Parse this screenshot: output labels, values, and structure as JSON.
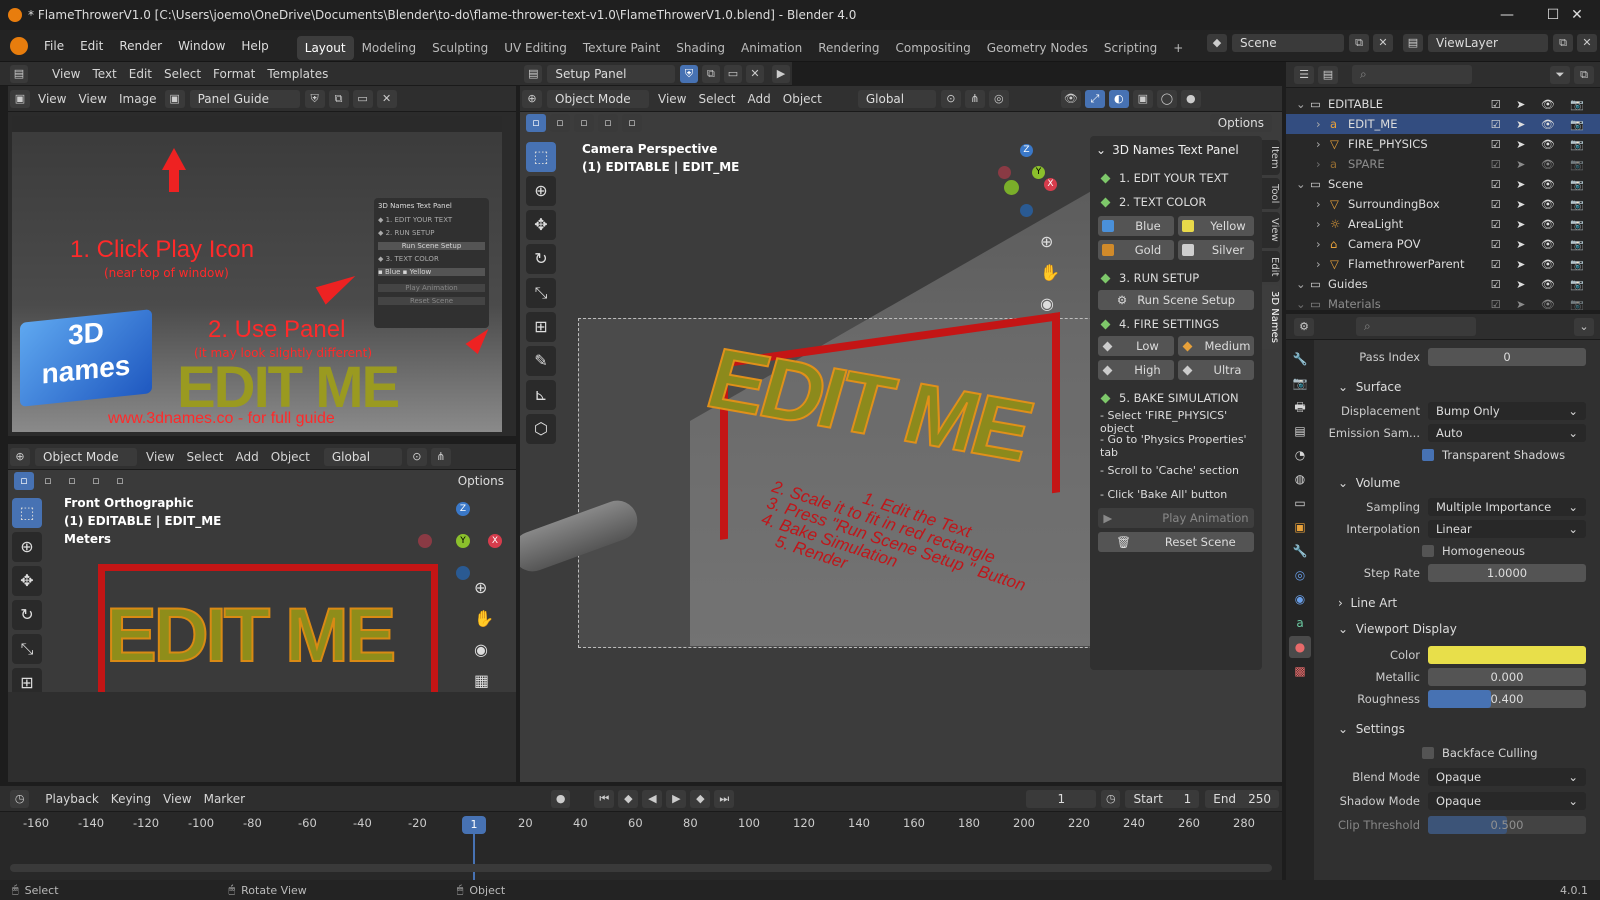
{
  "window": {
    "title": "* FlameThrowerV1.0 [C:\\Users\\joemo\\OneDrive\\Documents\\Blender\\to-do\\flame-thrower-text-v1.0\\FlameThrowerV1.0.blend] - Blender 4.0",
    "minimize": "—",
    "maximize": "☐",
    "close": "✕"
  },
  "menu": [
    "File",
    "Edit",
    "Render",
    "Window",
    "Help"
  ],
  "workspaces": [
    "Layout",
    "Modeling",
    "Sculpting",
    "UV Editing",
    "Texture Paint",
    "Shading",
    "Animation",
    "Rendering",
    "Compositing",
    "Geometry Nodes",
    "Scripting",
    "+"
  ],
  "scene": "Scene",
  "viewlayer": "ViewLayer",
  "text_editor": {
    "menus": [
      "View",
      "Text",
      "Edit",
      "Select",
      "Format",
      "Templates"
    ],
    "file": "Setup Panel"
  },
  "image_editor": {
    "menus": [
      "View",
      "View",
      "Image"
    ],
    "image": "Panel Guide"
  },
  "guide": {
    "step1": "1. Click Play Icon",
    "step1_sub": "(near top of window)",
    "step2": "2. Use Panel",
    "step2_sub": "(it may look slightly different)",
    "url": "www.3dnames.co - for full guide",
    "logo": "3D names"
  },
  "front_view": {
    "mode": "Object Mode",
    "menus": [
      "View",
      "Select",
      "Add",
      "Object"
    ],
    "orient": "Global",
    "options": "Options",
    "title": "Front Orthographic",
    "object": "(1) EDITABLE | EDIT_ME",
    "units": "Meters",
    "text": "EDIT ME"
  },
  "camera_view": {
    "mode": "Object Mode",
    "menus": [
      "View",
      "Select",
      "Add",
      "Object"
    ],
    "orient": "Global",
    "options": "Options",
    "title": "Camera Perspective",
    "object": "(1) EDITABLE | EDIT_ME",
    "text": "EDIT ME",
    "floor_text": [
      "1. Edit the Text",
      "2. Scale it to fit in red rectangle",
      "3. Press \"Run Scene Setup \" Button",
      "4. Bake Simulation",
      "5. Render"
    ]
  },
  "npanel": {
    "title": "3D Names Text Panel",
    "s1": "1. EDIT YOUR TEXT",
    "s2": "2. TEXT COLOR",
    "colors": [
      {
        "label": "Blue",
        "color": "#4a90d9"
      },
      {
        "label": "Yellow",
        "color": "#e8d94a"
      },
      {
        "label": "Gold",
        "color": "#d08a2a"
      },
      {
        "label": "Silver",
        "color": "#cfcfcf"
      }
    ],
    "s3": "3. RUN SETUP",
    "run": "Run Scene Setup",
    "s4": "4. FIRE SETTINGS",
    "fire": [
      {
        "label": "Low",
        "color": "#cccccc"
      },
      {
        "label": "Medium",
        "color": "#e8a13a"
      },
      {
        "label": "High",
        "color": "#cccccc"
      },
      {
        "label": "Ultra",
        "color": "#cccccc"
      }
    ],
    "s5": "5. BAKE SIMULATION",
    "steps": [
      "- Select 'FIRE_PHYSICS' object",
      "- Go to 'Physics Properties' tab",
      "- Scroll to 'Cache' section",
      "- Click 'Bake All' button"
    ],
    "play": "Play Animation",
    "reset": "Reset Scene",
    "tabs": [
      "Item",
      "Tool",
      "View",
      "Edit",
      "3D Names"
    ]
  },
  "outliner": {
    "items": [
      {
        "name": "EDITABLE",
        "indent": 0,
        "type": "collection"
      },
      {
        "name": "EDIT_ME",
        "indent": 1,
        "type": "text",
        "selected": true
      },
      {
        "name": "FIRE_PHYSICS",
        "indent": 1,
        "type": "mesh"
      },
      {
        "name": "SPARE",
        "indent": 1,
        "type": "text",
        "dim": true
      },
      {
        "name": "Scene",
        "indent": 0,
        "type": "collection"
      },
      {
        "name": "SurroundingBox",
        "indent": 1,
        "type": "mesh"
      },
      {
        "name": "AreaLight",
        "indent": 1,
        "type": "light"
      },
      {
        "name": "Camera POV",
        "indent": 1,
        "type": "camera"
      },
      {
        "name": "FlamethrowerParent",
        "indent": 1,
        "type": "mesh"
      },
      {
        "name": "Guides",
        "indent": 0,
        "type": "collection"
      },
      {
        "name": "Materials",
        "indent": 0,
        "type": "collection",
        "dim": true
      }
    ]
  },
  "properties": {
    "pass_index_label": "Pass Index",
    "pass_index": "0",
    "surface": "Surface",
    "displacement_label": "Displacement",
    "displacement": "Bump Only",
    "emission_label": "Emission Sam...",
    "emission": "Auto",
    "transparent_shadows": "Transparent Shadows",
    "volume": "Volume",
    "sampling_label": "Sampling",
    "sampling": "Multiple Importance",
    "interp_label": "Interpolation",
    "interp": "Linear",
    "homogeneous": "Homogeneous",
    "step_label": "Step Rate",
    "step": "1.0000",
    "lineart": "Line Art",
    "viewport": "Viewport Display",
    "color_label": "Color",
    "color": "#e8df4a",
    "metallic_label": "Metallic",
    "metallic": "0.000",
    "rough_label": "Roughness",
    "rough": "0.400",
    "rough_frac": 0.4,
    "settings": "Settings",
    "backface": "Backface Culling",
    "blend_label": "Blend Mode",
    "blend": "Opaque",
    "shadow_label": "Shadow Mode",
    "shadow": "Opaque",
    "clip_label": "Clip Threshold",
    "clip": "0.500",
    "clip_frac": 0.5
  },
  "timeline": {
    "menus": [
      "Playback",
      "Keying",
      "View",
      "Marker"
    ],
    "frame": "1",
    "start_label": "Start",
    "start": "1",
    "end_label": "End",
    "end": "250",
    "current": "1",
    "ticks": [
      "-160",
      "-140",
      "-120",
      "-100",
      "-80",
      "-60",
      "-40",
      "-20",
      "20",
      "40",
      "60",
      "80",
      "100",
      "120",
      "140",
      "160",
      "180",
      "200",
      "220",
      "240",
      "260",
      "280"
    ]
  },
  "status": {
    "select": "Select",
    "rotate": "Rotate View",
    "object": "Object",
    "version": "4.0.1"
  }
}
